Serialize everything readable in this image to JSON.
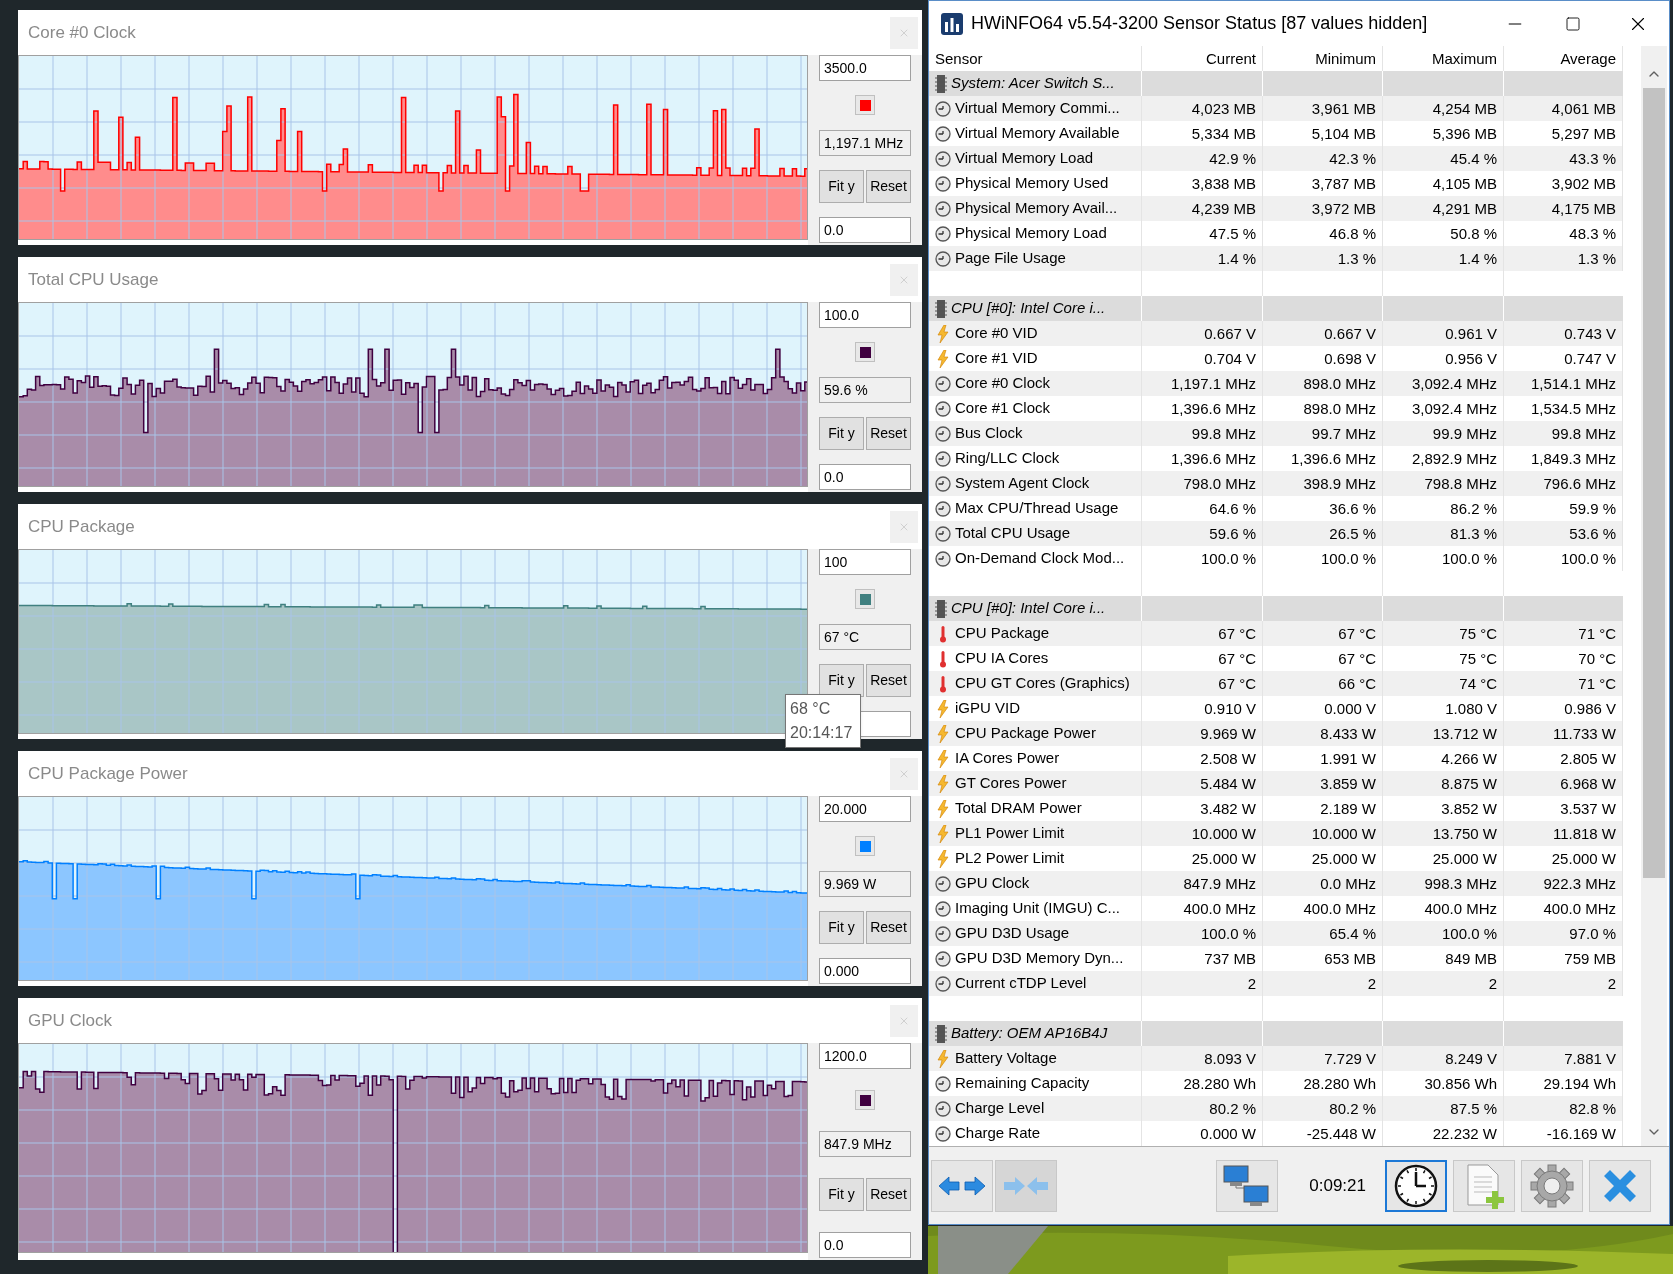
{
  "graphs": [
    {
      "title": "Core #0 Clock",
      "max": "3500.0",
      "min": "0.0",
      "reading": "1,197.1 MHz",
      "color": "#ff0000",
      "buttons": [
        "Fit y",
        "Reset"
      ]
    },
    {
      "title": "Total CPU Usage",
      "max": "100.0",
      "min": "0.0",
      "reading": "59.6 %",
      "color": "#400040",
      "buttons": [
        "Fit y",
        "Reset"
      ]
    },
    {
      "title": "CPU Package",
      "max": "100",
      "reading": "67 °C",
      "color": "#408080",
      "buttons": [
        "Fit y",
        "Reset"
      ],
      "tooltip": {
        "value": "68 °C",
        "time": "20:14:17"
      }
    },
    {
      "title": "CPU Package Power",
      "max": "20.000",
      "min": "0.000",
      "reading": "9.969 W",
      "color": "#0080ff",
      "buttons": [
        "Fit y",
        "Reset"
      ]
    },
    {
      "title": "GPU Clock",
      "max": "1200.0",
      "min": "0.0",
      "reading": "847.9 MHz",
      "color": "#400040",
      "buttons": [
        "Fit y",
        "Reset"
      ]
    }
  ],
  "sensor_window": {
    "title": "HWiNFO64 v5.54-3200 Sensor Status [87 values hidden]",
    "columns": [
      "Sensor",
      "Current",
      "Minimum",
      "Maximum",
      "Average"
    ],
    "groups": [
      {
        "title": "System: Acer Switch S...",
        "rows": [
          {
            "kind": "clock",
            "name": "Virtual Memory Commi...",
            "values": [
              "4,023 MB",
              "3,961 MB",
              "4,254 MB",
              "4,061 MB"
            ]
          },
          {
            "kind": "clock",
            "name": "Virtual Memory Available",
            "values": [
              "5,334 MB",
              "5,104 MB",
              "5,396 MB",
              "5,297 MB"
            ]
          },
          {
            "kind": "clock",
            "name": "Virtual Memory Load",
            "values": [
              "42.9 %",
              "42.3 %",
              "45.4 %",
              "43.3 %"
            ]
          },
          {
            "kind": "clock",
            "name": "Physical Memory Used",
            "values": [
              "3,838 MB",
              "3,787 MB",
              "4,105 MB",
              "3,902 MB"
            ]
          },
          {
            "kind": "clock",
            "name": "Physical Memory Avail...",
            "values": [
              "4,239 MB",
              "3,972 MB",
              "4,291 MB",
              "4,175 MB"
            ]
          },
          {
            "kind": "clock",
            "name": "Physical Memory Load",
            "values": [
              "47.5 %",
              "46.8 %",
              "50.8 %",
              "48.3 %"
            ]
          },
          {
            "kind": "clock",
            "name": "Page File Usage",
            "values": [
              "1.4 %",
              "1.3 %",
              "1.4 %",
              "1.3 %"
            ]
          }
        ]
      },
      {
        "title": "CPU [#0]: Intel Core i...",
        "rows": [
          {
            "kind": "volt",
            "name": "Core #0 VID",
            "values": [
              "0.667 V",
              "0.667 V",
              "0.961 V",
              "0.743 V"
            ]
          },
          {
            "kind": "volt",
            "name": "Core #1 VID",
            "values": [
              "0.704 V",
              "0.698 V",
              "0.956 V",
              "0.747 V"
            ]
          },
          {
            "kind": "clock",
            "name": "Core #0 Clock",
            "values": [
              "1,197.1 MHz",
              "898.0 MHz",
              "3,092.4 MHz",
              "1,514.1 MHz"
            ]
          },
          {
            "kind": "clock",
            "name": "Core #1 Clock",
            "values": [
              "1,396.6 MHz",
              "898.0 MHz",
              "3,092.4 MHz",
              "1,534.5 MHz"
            ]
          },
          {
            "kind": "clock",
            "name": "Bus Clock",
            "values": [
              "99.8 MHz",
              "99.7 MHz",
              "99.9 MHz",
              "99.8 MHz"
            ]
          },
          {
            "kind": "clock",
            "name": "Ring/LLC Clock",
            "values": [
              "1,396.6 MHz",
              "1,396.6 MHz",
              "2,892.9 MHz",
              "1,849.3 MHz"
            ]
          },
          {
            "kind": "clock",
            "name": "System Agent Clock",
            "values": [
              "798.0 MHz",
              "398.9 MHz",
              "798.8 MHz",
              "796.6 MHz"
            ]
          },
          {
            "kind": "clock",
            "name": "Max CPU/Thread Usage",
            "values": [
              "64.6 %",
              "36.6 %",
              "86.2 %",
              "59.9 %"
            ]
          },
          {
            "kind": "clock",
            "name": "Total CPU Usage",
            "values": [
              "59.6 %",
              "26.5 %",
              "81.3 %",
              "53.6 %"
            ]
          },
          {
            "kind": "clock",
            "name": "On-Demand Clock Mod...",
            "values": [
              "100.0 %",
              "100.0 %",
              "100.0 %",
              "100.0 %"
            ]
          }
        ]
      },
      {
        "title": "CPU [#0]: Intel Core i...",
        "rows": [
          {
            "kind": "temp",
            "name": "CPU Package",
            "values": [
              "67 °C",
              "67 °C",
              "75 °C",
              "71 °C"
            ]
          },
          {
            "kind": "temp",
            "name": "CPU IA Cores",
            "values": [
              "67 °C",
              "67 °C",
              "75 °C",
              "70 °C"
            ]
          },
          {
            "kind": "temp",
            "name": "CPU GT Cores (Graphics)",
            "values": [
              "67 °C",
              "66 °C",
              "74 °C",
              "71 °C"
            ]
          },
          {
            "kind": "volt",
            "name": "iGPU VID",
            "values": [
              "0.910 V",
              "0.000 V",
              "1.080 V",
              "0.986 V"
            ]
          },
          {
            "kind": "volt",
            "name": "CPU Package Power",
            "values": [
              "9.969 W",
              "8.433 W",
              "13.712 W",
              "11.733 W"
            ]
          },
          {
            "kind": "volt",
            "name": "IA Cores Power",
            "values": [
              "2.508 W",
              "1.991 W",
              "4.266 W",
              "2.805 W"
            ]
          },
          {
            "kind": "volt",
            "name": "GT Cores Power",
            "values": [
              "5.484 W",
              "3.859 W",
              "8.875 W",
              "6.968 W"
            ]
          },
          {
            "kind": "volt",
            "name": "Total DRAM Power",
            "values": [
              "3.482 W",
              "2.189 W",
              "3.852 W",
              "3.537 W"
            ]
          },
          {
            "kind": "volt",
            "name": "PL1 Power Limit",
            "values": [
              "10.000 W",
              "10.000 W",
              "13.750 W",
              "11.818 W"
            ]
          },
          {
            "kind": "volt",
            "name": "PL2 Power Limit",
            "values": [
              "25.000 W",
              "25.000 W",
              "25.000 W",
              "25.000 W"
            ]
          },
          {
            "kind": "clock",
            "name": "GPU Clock",
            "values": [
              "847.9 MHz",
              "0.0 MHz",
              "998.3 MHz",
              "922.3 MHz"
            ]
          },
          {
            "kind": "clock",
            "name": "Imaging Unit (IMGU) C...",
            "values": [
              "400.0 MHz",
              "400.0 MHz",
              "400.0 MHz",
              "400.0 MHz"
            ]
          },
          {
            "kind": "clock",
            "name": "GPU D3D Usage",
            "values": [
              "100.0 %",
              "65.4 %",
              "100.0 %",
              "97.0 %"
            ]
          },
          {
            "kind": "clock",
            "name": "GPU D3D Memory Dyn...",
            "values": [
              "737 MB",
              "653 MB",
              "849 MB",
              "759 MB"
            ]
          },
          {
            "kind": "clock",
            "name": "Current cTDP Level",
            "values": [
              "2",
              "2",
              "2",
              "2"
            ]
          }
        ]
      },
      {
        "title": "Battery: OEM AP16B4J",
        "rows": [
          {
            "kind": "volt",
            "name": "Battery Voltage",
            "values": [
              "8.093 V",
              "7.729 V",
              "8.249 V",
              "7.881 V"
            ]
          },
          {
            "kind": "clock",
            "name": "Remaining Capacity",
            "values": [
              "28.280 Wh",
              "28.280 Wh",
              "30.856 Wh",
              "29.194 Wh"
            ]
          },
          {
            "kind": "clock",
            "name": "Charge Level",
            "values": [
              "80.2 %",
              "80.2 %",
              "87.5 %",
              "82.8 %"
            ]
          },
          {
            "kind": "clock",
            "name": "Charge Rate",
            "values": [
              "0.000 W",
              "-25.448 W",
              "22.232 W",
              "-16.169 W"
            ]
          }
        ]
      }
    ],
    "toolbar_left": [
      {
        "kind": "expand",
        "disabled": false
      },
      {
        "kind": "collapse",
        "disabled": true
      },
      {
        "kind": "network",
        "disabled": false
      }
    ],
    "timer": "0:09:21",
    "toolbar_right": [
      {
        "kind": "clock",
        "selected": true
      },
      {
        "kind": "report",
        "selected": false
      },
      {
        "kind": "settings",
        "selected": false
      },
      {
        "kind": "close",
        "selected": false
      }
    ]
  }
}
